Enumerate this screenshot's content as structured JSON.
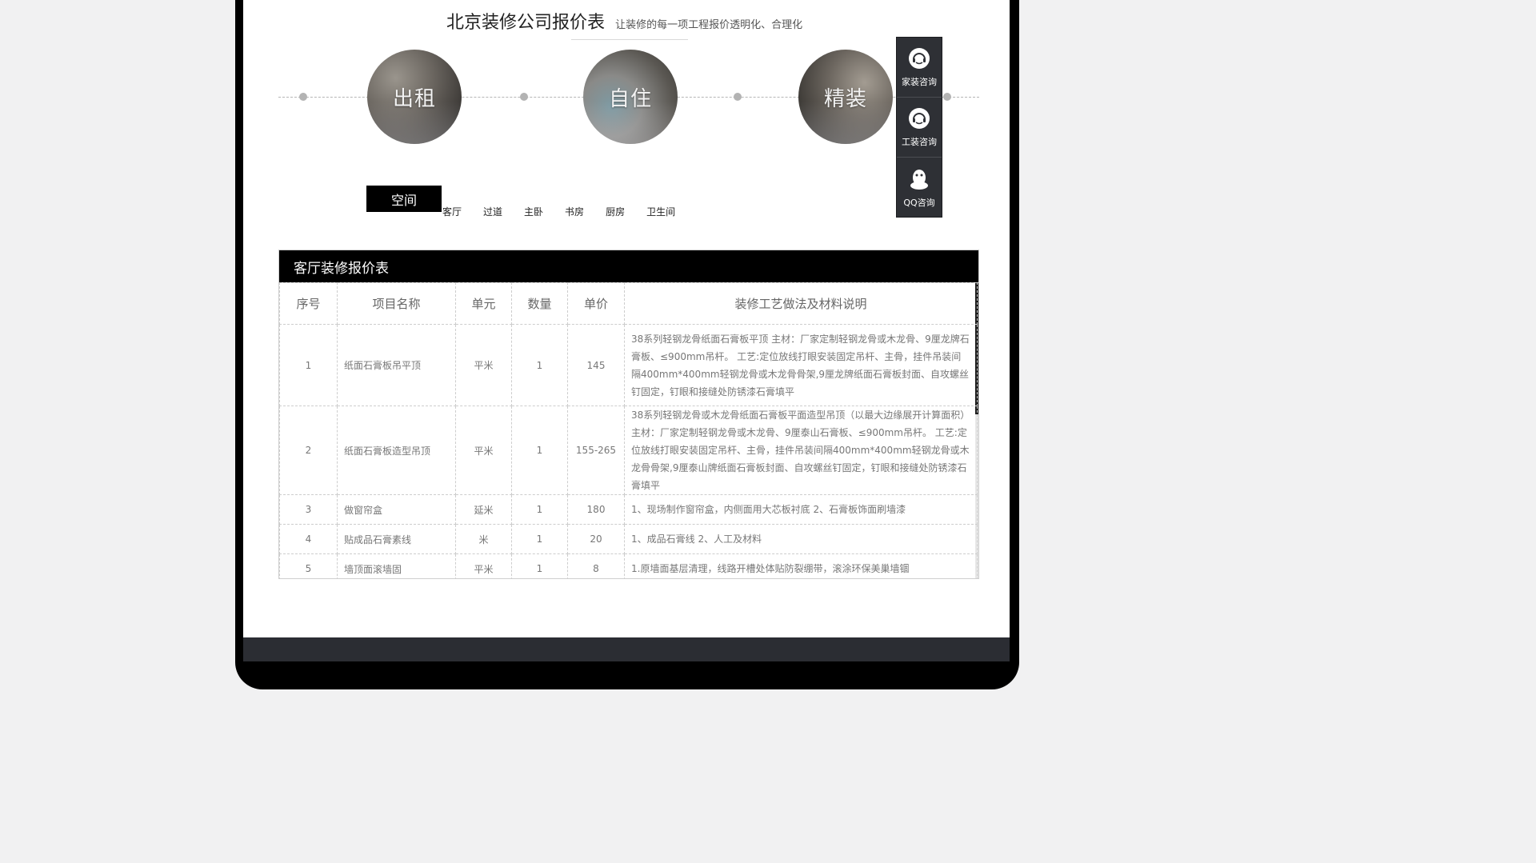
{
  "header": {
    "title": "北京装修公司报价表",
    "subtitle": "让装修的每一项工程报价透明化、合理化"
  },
  "circles": [
    {
      "label": "出租"
    },
    {
      "label": "自住"
    },
    {
      "label": "精装"
    }
  ],
  "float_menu": [
    {
      "label": "家装咨询",
      "icon": "headset-icon"
    },
    {
      "label": "工装咨询",
      "icon": "headset-icon"
    },
    {
      "label": "QQ咨询",
      "icon": "qq-penguin-icon"
    }
  ],
  "space": {
    "tab_label": "空间",
    "rooms": [
      "客厅",
      "过道",
      "主卧",
      "书房",
      "厨房",
      "卫生间"
    ]
  },
  "table": {
    "title": "客厅装修报价表",
    "columns": [
      "序号",
      "项目名称",
      "单元",
      "数量",
      "单价",
      "装修工艺做法及材料说明"
    ],
    "rows": [
      {
        "no": "1",
        "name": "纸面石膏板吊平顶",
        "unit": "平米",
        "qty": "1",
        "price": "145",
        "desc": "38系列轻钢龙骨纸面石膏板平顶 主材：厂家定制轻钢龙骨或木龙骨、9厘龙牌石膏板、≤900mm吊杆。 工艺:定位放线打眼安装固定吊杆、主骨，挂件吊装间隔400mm*400mm轻钢龙骨或木龙骨骨架,9厘龙牌纸面石膏板封面、自攻螺丝钉固定，钉眼和接缝处防锈漆石膏填平"
      },
      {
        "no": "2",
        "name": "纸面石膏板造型吊顶",
        "unit": "平米",
        "qty": "1",
        "price": "155-265",
        "desc": "38系列轻钢龙骨或木龙骨纸面石膏板平面造型吊顶（以最大边缘展开计算面积） 主材：厂家定制轻钢龙骨或木龙骨、9厘泰山石膏板、≤900mm吊杆。 工艺:定位放线打眼安装固定吊杆、主骨，挂件吊装间隔400mm*400mm轻钢龙骨或木龙骨骨架,9厘泰山牌纸面石膏板封面、自攻螺丝钉固定，钉眼和接缝处防锈漆石膏填平"
      },
      {
        "no": "3",
        "name": "做窗帘盒",
        "unit": "延米",
        "qty": "1",
        "price": "180",
        "desc": "1、现场制作窗帘盒，内侧面用大芯板衬底 2、石膏板饰面刷墙漆"
      },
      {
        "no": "4",
        "name": "贴成品石膏素线",
        "unit": "米",
        "qty": "1",
        "price": "20",
        "desc": "1、成品石膏线 2、人工及材料"
      },
      {
        "no": "5",
        "name": "墙顶面滚墙固",
        "unit": "平米",
        "qty": "1",
        "price": "8",
        "desc": "1.原墙面基层清理，线路开槽处体贴防裂绷带，滚涂环保美巢墙锢"
      }
    ]
  }
}
